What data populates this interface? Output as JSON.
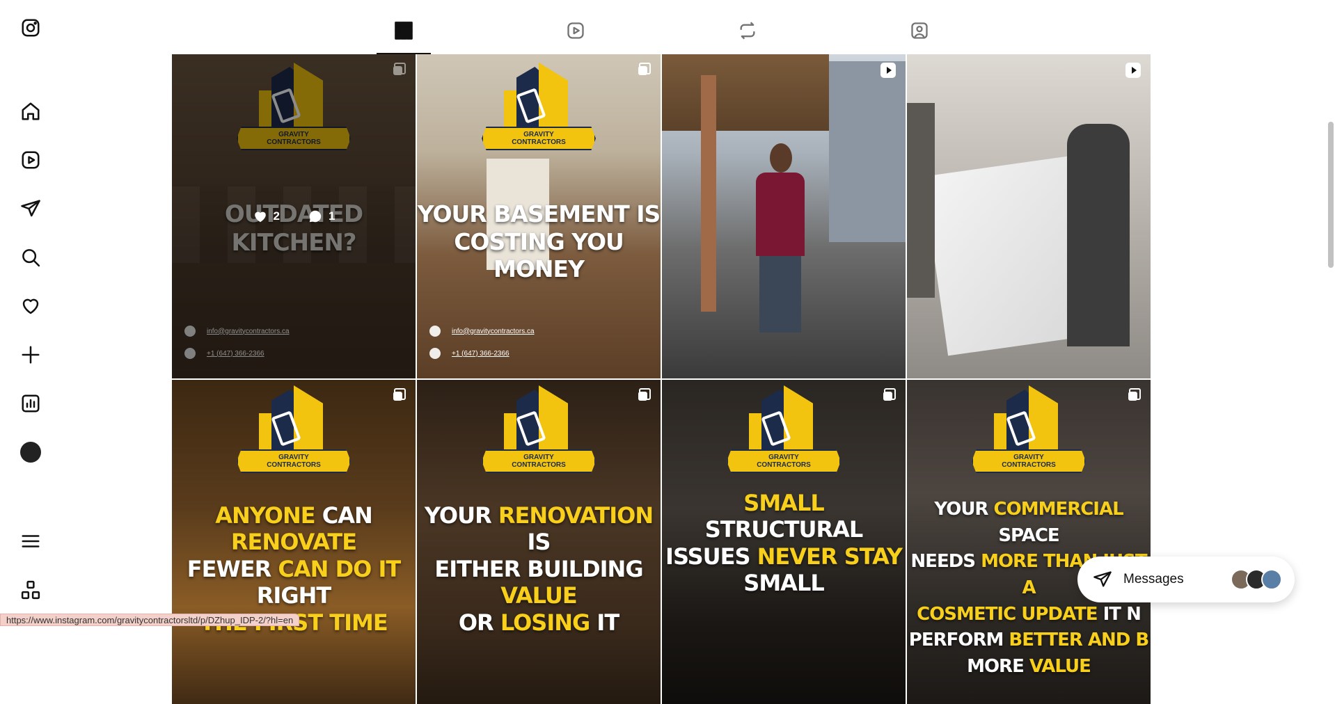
{
  "sidebar": {
    "items": [
      {
        "name": "instagram-logo-icon"
      },
      {
        "name": "home-icon"
      },
      {
        "name": "reels-icon"
      },
      {
        "name": "messages-icon"
      },
      {
        "name": "search-icon"
      },
      {
        "name": "notifications-icon"
      },
      {
        "name": "create-icon"
      },
      {
        "name": "dashboard-icon"
      },
      {
        "name": "profile-avatar"
      },
      {
        "name": "menu-icon"
      },
      {
        "name": "more-apps-icon"
      }
    ]
  },
  "tabs": [
    {
      "name": "posts-grid-icon",
      "active": true
    },
    {
      "name": "reels-icon",
      "active": false
    },
    {
      "name": "reposts-icon",
      "active": false
    },
    {
      "name": "tagged-icon",
      "active": false
    }
  ],
  "posts": [
    {
      "id": "p1",
      "headline": "OUTDATED KITCHEN?",
      "logo_line1": "GRAVITY",
      "logo_line2": "CONTRACTORS",
      "email": "info@gravitycontractors.ca",
      "phone": "+1 (647) 366-2366",
      "likes": "2",
      "comments": "1",
      "type": "carousel"
    },
    {
      "id": "p2",
      "headline_line1": "YOUR BASEMENT IS",
      "headline_line2": "COSTING YOU MONEY",
      "logo_line1": "GRAVITY",
      "logo_line2": "CONTRACTORS",
      "email": "info@gravitycontractors.ca",
      "phone": "+1 (647) 366-2366",
      "type": "carousel"
    },
    {
      "id": "p3",
      "type": "reel"
    },
    {
      "id": "p4",
      "type": "reel"
    },
    {
      "id": "p5",
      "logo_line1": "GRAVITY",
      "logo_line2": "CONTRACTORS",
      "l1_a": "ANYONE",
      "l1_b": "CAN",
      "l1_c": "RENOVATE",
      "l2_a": "FEWER",
      "l2_b": "CAN DO IT",
      "l2_c": "RIGHT",
      "l3": "THE FIRST TIME",
      "type": "carousel"
    },
    {
      "id": "p6",
      "logo_line1": "GRAVITY",
      "logo_line2": "CONTRACTORS",
      "l1_a": "YOUR",
      "l1_b": "RENOVATION",
      "l1_c": "IS",
      "l2_a": "EITHER BUILDING",
      "l2_b": "VALUE",
      "l3_a": "OR",
      "l3_b": "LOSING",
      "l3_c": "IT",
      "type": "carousel"
    },
    {
      "id": "p7",
      "logo_line1": "GRAVITY",
      "logo_line2": "CONTRACTORS",
      "l1_a": "SMALL",
      "l1_b": "STRUCTURAL",
      "l2_a": "ISSUES",
      "l2_b": "NEVER STAY",
      "l3": "SMALL",
      "type": "carousel"
    },
    {
      "id": "p8",
      "logo_line1": "GRAVITY",
      "logo_line2": "CONTRACTORS",
      "l1_a": "YOUR",
      "l1_b": "COMMERCIAL",
      "l1_c": "SPACE",
      "l2_a": "NEEDS",
      "l2_b": "MORE THAN JUST A",
      "l3_a": "COSMETIC UPDATE",
      "l3_b": "IT N",
      "l4_a": "PERFORM",
      "l4_b": "BETTER AND B",
      "l5_a": "MORE",
      "l5_b": "VALUE",
      "type": "carousel"
    }
  ],
  "messages": {
    "label": "Messages"
  },
  "status_url": "https://www.instagram.com/gravitycontractorsltd/p/DZhup_IDP-2/?hl=en",
  "colors": {
    "accent_yellow": "#f8cf1b",
    "brand_navy": "#1c2b4a"
  }
}
